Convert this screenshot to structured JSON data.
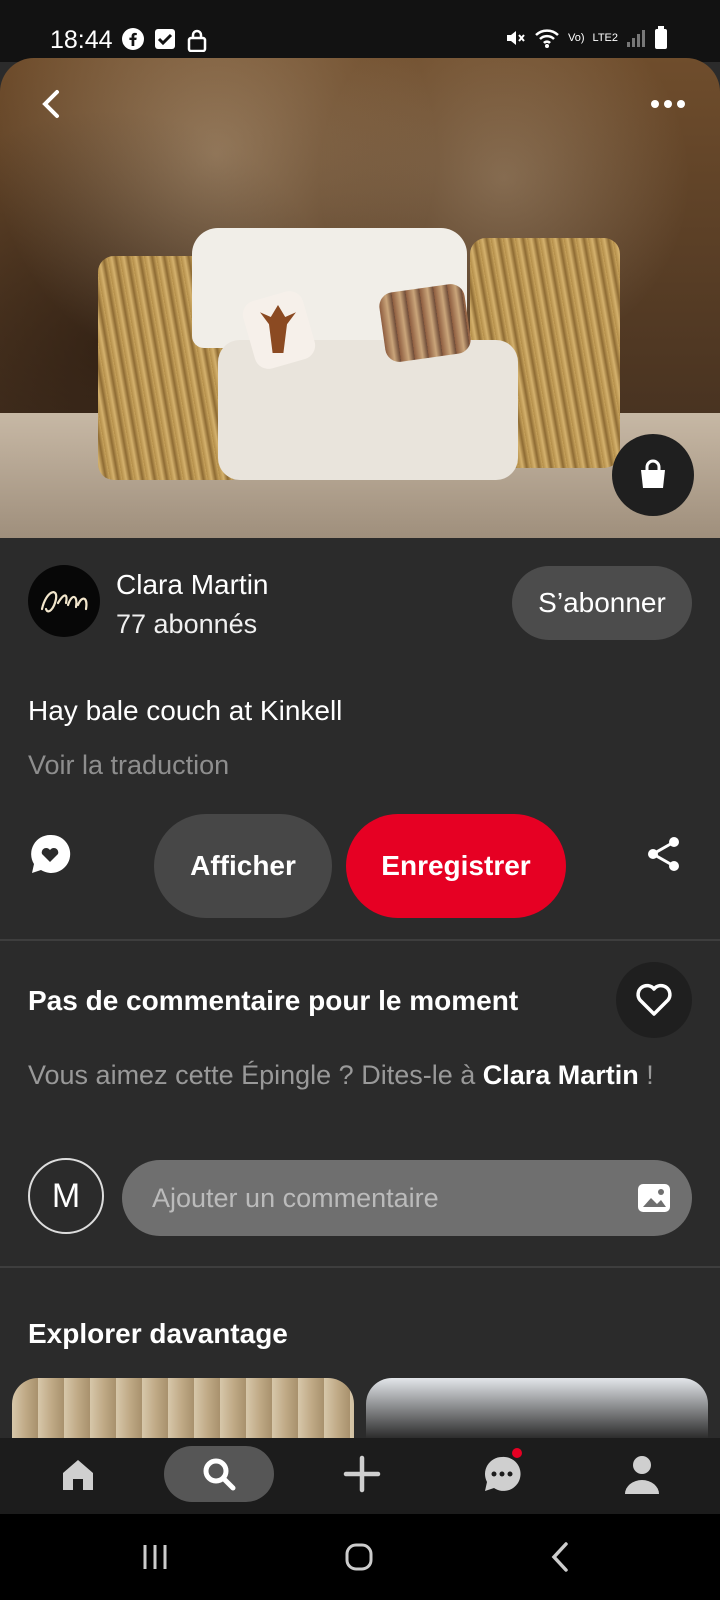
{
  "status_bar": {
    "time": "18:44",
    "network": "LTE2",
    "volte": "Vo)"
  },
  "pin": {
    "title": "Hay bale couch at Kinkell",
    "translate_label": "Voir la traduction"
  },
  "author": {
    "name": "Clara Martin",
    "followers": "77 abonnés",
    "follow_label": "S’abonner"
  },
  "actions": {
    "view_label": "Afficher",
    "save_label": "Enregistrer"
  },
  "comments": {
    "title": "Pas de commentaire pour le moment",
    "prompt_prefix": "Vous aimez cette Épingle ? Dites-le à ",
    "prompt_name": "Clara Martin",
    "prompt_suffix": " !",
    "user_initial": "M",
    "input_placeholder": "Ajouter un commentaire"
  },
  "explore": {
    "title": "Explorer davantage"
  },
  "colors": {
    "accent": "#e60023",
    "background": "#2b2b2b"
  }
}
